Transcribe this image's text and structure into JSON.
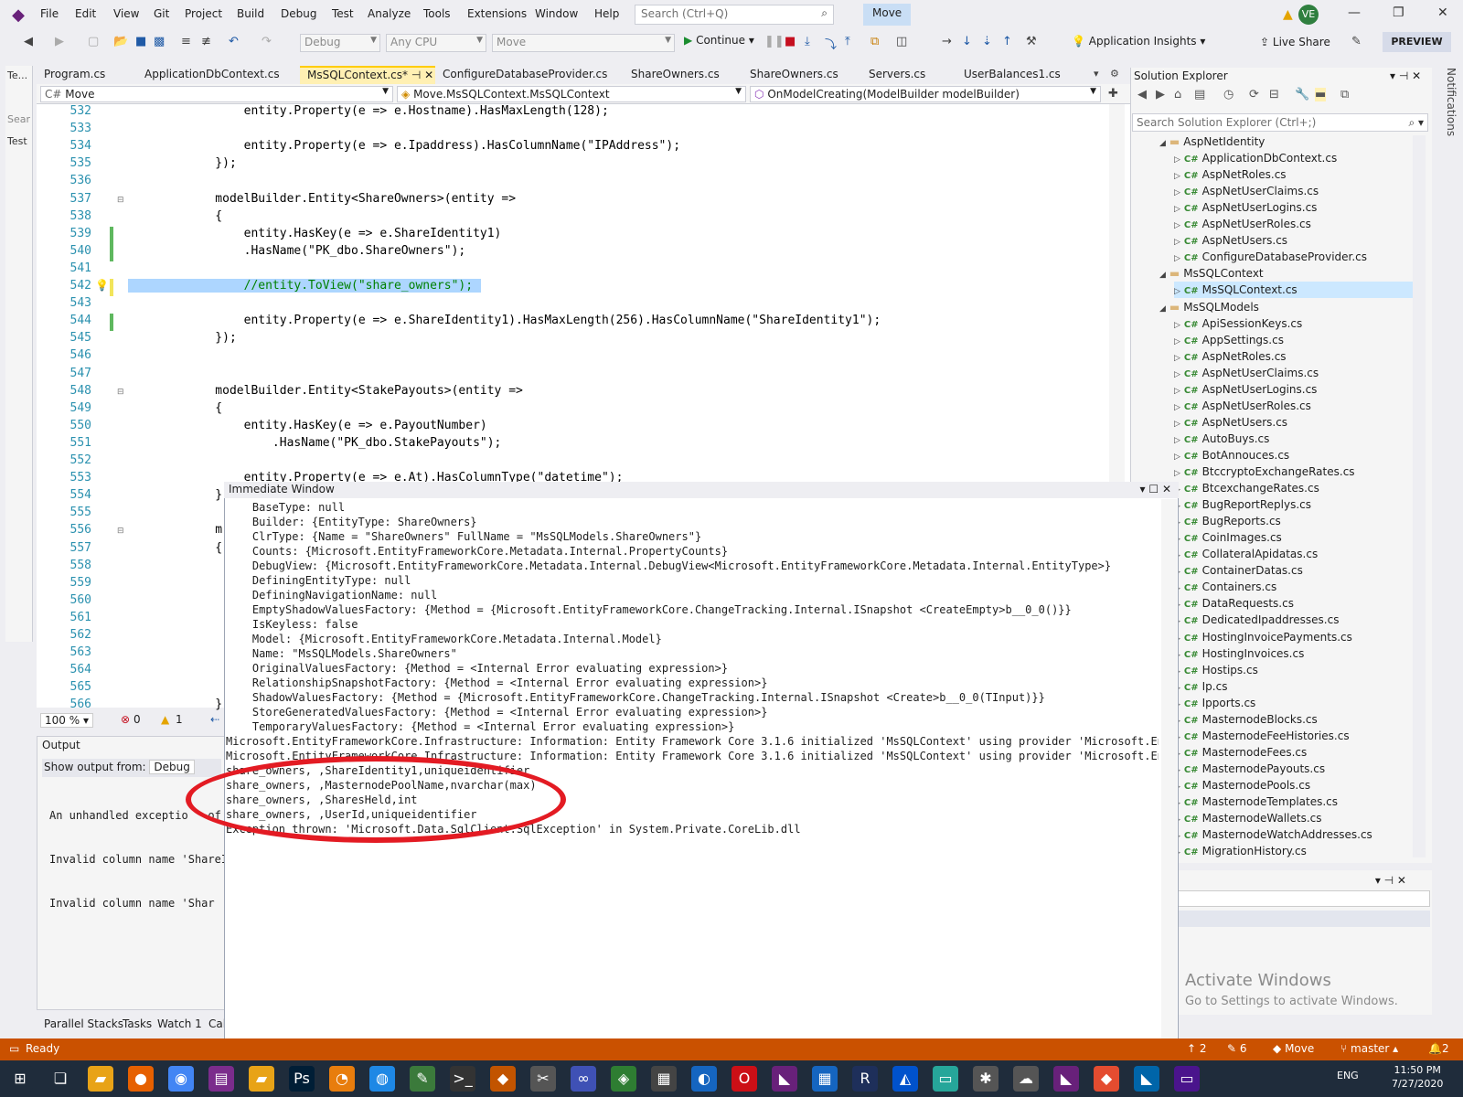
{
  "menubar": {
    "items": [
      "File",
      "Edit",
      "View",
      "Git",
      "Project",
      "Build",
      "Debug",
      "Test",
      "Analyze",
      "Tools",
      "Extensions",
      "Window",
      "Help"
    ],
    "search_placeholder": "Search (Ctrl+Q)",
    "solution_name": "Move",
    "avatar_initials": "VE"
  },
  "toolbar": {
    "config": "Debug",
    "platform": "Any CPU",
    "startup": "Move",
    "continue_label": "Continue",
    "app_insights": "Application Insights",
    "live_share": "Live Share",
    "preview": "PREVIEW"
  },
  "left_strip": {
    "items": [
      "Te...",
      "Sear",
      "Test"
    ]
  },
  "tabs": [
    "Program.cs",
    "ApplicationDbContext.cs",
    "MsSQLContext.cs*",
    "ConfigureDatabaseProvider.cs",
    "ShareOwners.cs",
    "ShareOwners.cs",
    "Servers.cs",
    "UserBalances1.cs"
  ],
  "active_tab_index": 2,
  "navbar": {
    "project": "Move",
    "class": "Move.MsSQLContext.MsSQLContext",
    "member": "OnModelCreating(ModelBuilder modelBuilder)"
  },
  "editor": {
    "lines": [
      {
        "n": "532",
        "text": "        entity.Property(e => e.Hostname).HasMaxLength(128);"
      },
      {
        "n": "533",
        "text": ""
      },
      {
        "n": "534",
        "text": "        entity.Property(e => e.Ipaddress).HasColumnName(\"IPAddress\");"
      },
      {
        "n": "535",
        "text": "    });"
      },
      {
        "n": "536",
        "text": ""
      },
      {
        "n": "537",
        "text": "    modelBuilder.Entity<ShareOwners>(entity =>"
      },
      {
        "n": "538",
        "text": "    {"
      },
      {
        "n": "539",
        "text": "        entity.HasKey(e => e.ShareIdentity1)"
      },
      {
        "n": "540",
        "text": "        .HasName(\"PK_dbo.ShareOwners\");"
      },
      {
        "n": "541",
        "text": ""
      },
      {
        "n": "542",
        "text": "        //entity.ToView(\"share_owners\");"
      },
      {
        "n": "543",
        "text": ""
      },
      {
        "n": "544",
        "text": "        entity.Property(e => e.ShareIdentity1).HasMaxLength(256).HasColumnName(\"ShareIdentity1\");"
      },
      {
        "n": "545",
        "text": "    });"
      },
      {
        "n": "546",
        "text": ""
      },
      {
        "n": "547",
        "text": ""
      },
      {
        "n": "548",
        "text": "    modelBuilder.Entity<StakePayouts>(entity =>"
      },
      {
        "n": "549",
        "text": "    {"
      },
      {
        "n": "550",
        "text": "        entity.HasKey(e => e.PayoutNumber)"
      },
      {
        "n": "551",
        "text": "            .HasName(\"PK_dbo.StakePayouts\");"
      },
      {
        "n": "552",
        "text": ""
      },
      {
        "n": "553",
        "text": "        entity.Property(e => e.At).HasColumnType(\"datetime\");"
      },
      {
        "n": "554",
        "text": "    }"
      },
      {
        "n": "555",
        "text": ""
      },
      {
        "n": "556",
        "text": "    m"
      },
      {
        "n": "557",
        "text": "    {"
      },
      {
        "n": "558",
        "text": ""
      },
      {
        "n": "559",
        "text": ""
      },
      {
        "n": "560",
        "text": ""
      },
      {
        "n": "561",
        "text": ""
      },
      {
        "n": "562",
        "text": ""
      },
      {
        "n": "563",
        "text": ""
      },
      {
        "n": "564",
        "text": ""
      },
      {
        "n": "565",
        "text": ""
      },
      {
        "n": "566",
        "text": "    }"
      }
    ],
    "zoom": "100 %",
    "errors": "0",
    "warnings": "1"
  },
  "output": {
    "title": "Output",
    "show_from_label": "Show output from:",
    "show_from_value": "Debug",
    "lines": [
      "An unhandled exceptio   of t",
      "Invalid column name 'ShareI",
      "Invalid column name 'Shar"
    ]
  },
  "bottom_tabs": [
    "Parallel Stacks",
    "Tasks",
    "Watch 1",
    "Cal"
  ],
  "immediate": {
    "title": "Immediate Window",
    "lines": [
      "    BaseType: null",
      "    Builder: {EntityType: ShareOwners}",
      "    ClrType: {Name = \"ShareOwners\" FullName = \"MsSQLModels.ShareOwners\"}",
      "    Counts: {Microsoft.EntityFrameworkCore.Metadata.Internal.PropertyCounts}",
      "    DebugView: {Microsoft.EntityFrameworkCore.Metadata.Internal.DebugView<Microsoft.EntityFrameworkCore.Metadata.Internal.EntityType>}",
      "    DefiningEntityType: null",
      "    DefiningNavigationName: null",
      "    EmptyShadowValuesFactory: {Method = {Microsoft.EntityFrameworkCore.ChangeTracking.Internal.ISnapshot <CreateEmpty>b__0_0()}}",
      "    IsKeyless: false",
      "    Model: {Microsoft.EntityFrameworkCore.Metadata.Internal.Model}",
      "    Name: \"MsSQLModels.ShareOwners\"",
      "    OriginalValuesFactory: {Method = <Internal Error evaluating expression>}",
      "    RelationshipSnapshotFactory: {Method = <Internal Error evaluating expression>}",
      "    ShadowValuesFactory: {Method = {Microsoft.EntityFrameworkCore.ChangeTracking.Internal.ISnapshot <Create>b__0_0(TInput)}}",
      "    StoreGeneratedValuesFactory: {Method = <Internal Error evaluating expression>}",
      "    TemporaryValuesFactory: {Method = <Internal Error evaluating expression>}",
      "Microsoft.EntityFrameworkCore.Infrastructure: Information: Entity Framework Core 3.1.6 initialized 'MsSQLContext' using provider 'Microsoft.EntityF",
      "Microsoft.EntityFrameworkCore.Infrastructure: Information: Entity Framework Core 3.1.6 initialized 'MsSQLContext' using provider 'Microsoft.EntityF",
      "share_owners, ,ShareIdentity1,uniqueidentifier",
      "share_owners, ,MasternodePoolName,nvarchar(max)",
      "share_owners, ,SharesHeld,int",
      "share_owners, ,UserId,uniqueidentifier",
      "Exception thrown: 'Microsoft.Data.SqlClient.SqlException' in System.Private.CoreLib.dll"
    ]
  },
  "solution_explorer": {
    "title": "Solution Explorer",
    "search_placeholder": "Search Solution Explorer (Ctrl+;)",
    "items": [
      {
        "label": "AspNetIdentity",
        "type": "folder",
        "depth": 0
      },
      {
        "label": "ApplicationDbContext.cs",
        "type": "file",
        "depth": 1
      },
      {
        "label": "AspNetRoles.cs",
        "type": "file",
        "depth": 1
      },
      {
        "label": "AspNetUserClaims.cs",
        "type": "file",
        "depth": 1
      },
      {
        "label": "AspNetUserLogins.cs",
        "type": "file",
        "depth": 1
      },
      {
        "label": "AspNetUserRoles.cs",
        "type": "file",
        "depth": 1
      },
      {
        "label": "AspNetUsers.cs",
        "type": "file",
        "depth": 1
      },
      {
        "label": "ConfigureDatabaseProvider.cs",
        "type": "file",
        "depth": 1
      },
      {
        "label": "MsSQLContext",
        "type": "folder",
        "depth": 0
      },
      {
        "label": "MsSQLContext.cs",
        "type": "file",
        "depth": 1
      },
      {
        "label": "MsSQLModels",
        "type": "folder",
        "depth": 0
      },
      {
        "label": "ApiSessionKeys.cs",
        "type": "file",
        "depth": 1
      },
      {
        "label": "AppSettings.cs",
        "type": "file",
        "depth": 1
      },
      {
        "label": "AspNetRoles.cs",
        "type": "file",
        "depth": 1
      },
      {
        "label": "AspNetUserClaims.cs",
        "type": "file",
        "depth": 1
      },
      {
        "label": "AspNetUserLogins.cs",
        "type": "file",
        "depth": 1
      },
      {
        "label": "AspNetUserRoles.cs",
        "type": "file",
        "depth": 1
      },
      {
        "label": "AspNetUsers.cs",
        "type": "file",
        "depth": 1
      },
      {
        "label": "AutoBuys.cs",
        "type": "file",
        "depth": 1
      },
      {
        "label": "BotAnnouces.cs",
        "type": "file",
        "depth": 1
      },
      {
        "label": "BtccryptoExchangeRates.cs",
        "type": "file",
        "depth": 1
      },
      {
        "label": "BtcexchangeRates.cs",
        "type": "file",
        "depth": 1
      },
      {
        "label": "BugReportReplys.cs",
        "type": "file",
        "depth": 1
      },
      {
        "label": "BugReports.cs",
        "type": "file",
        "depth": 1
      },
      {
        "label": "CoinImages.cs",
        "type": "file",
        "depth": 1
      },
      {
        "label": "CollateralApidatas.cs",
        "type": "file",
        "depth": 1
      },
      {
        "label": "ContainerDatas.cs",
        "type": "file",
        "depth": 1
      },
      {
        "label": "Containers.cs",
        "type": "file",
        "depth": 1
      },
      {
        "label": "DataRequests.cs",
        "type": "file",
        "depth": 1
      },
      {
        "label": "DedicatedIpaddresses.cs",
        "type": "file",
        "depth": 1
      },
      {
        "label": "HostingInvoicePayments.cs",
        "type": "file",
        "depth": 1
      },
      {
        "label": "HostingInvoices.cs",
        "type": "file",
        "depth": 1
      },
      {
        "label": "Hostips.cs",
        "type": "file",
        "depth": 1
      },
      {
        "label": "Ip.cs",
        "type": "file",
        "depth": 1
      },
      {
        "label": "Ipports.cs",
        "type": "file",
        "depth": 1
      },
      {
        "label": "MasternodeBlocks.cs",
        "type": "file",
        "depth": 1
      },
      {
        "label": "MasternodeFeeHistories.cs",
        "type": "file",
        "depth": 1
      },
      {
        "label": "MasternodeFees.cs",
        "type": "file",
        "depth": 1
      },
      {
        "label": "MasternodePayouts.cs",
        "type": "file",
        "depth": 1
      },
      {
        "label": "MasternodePools.cs",
        "type": "file",
        "depth": 1
      },
      {
        "label": "MasternodeTemplates.cs",
        "type": "file",
        "depth": 1
      },
      {
        "label": "MasternodeWallets.cs",
        "type": "file",
        "depth": 1
      },
      {
        "label": "MasternodeWatchAddresses.cs",
        "type": "file",
        "depth": 1
      },
      {
        "label": "MigrationHistory.cs",
        "type": "file",
        "depth": 1
      }
    ]
  },
  "watermark": {
    "line1": "Activate Windows",
    "line2": "Go to Settings to activate Windows."
  },
  "notifications": "Notifications",
  "status": {
    "ready": "Ready",
    "up": "2",
    "pencil": "6",
    "repo": "Move",
    "branch": "master",
    "bell": "2"
  },
  "clock": {
    "time": "11:50 PM",
    "date": "7/27/2020",
    "lang": "ENG"
  },
  "colors": {
    "accent": "#68217a",
    "status_bar": "#ca5100",
    "selection": "#add6ff",
    "ellipse": "#e31b23"
  }
}
